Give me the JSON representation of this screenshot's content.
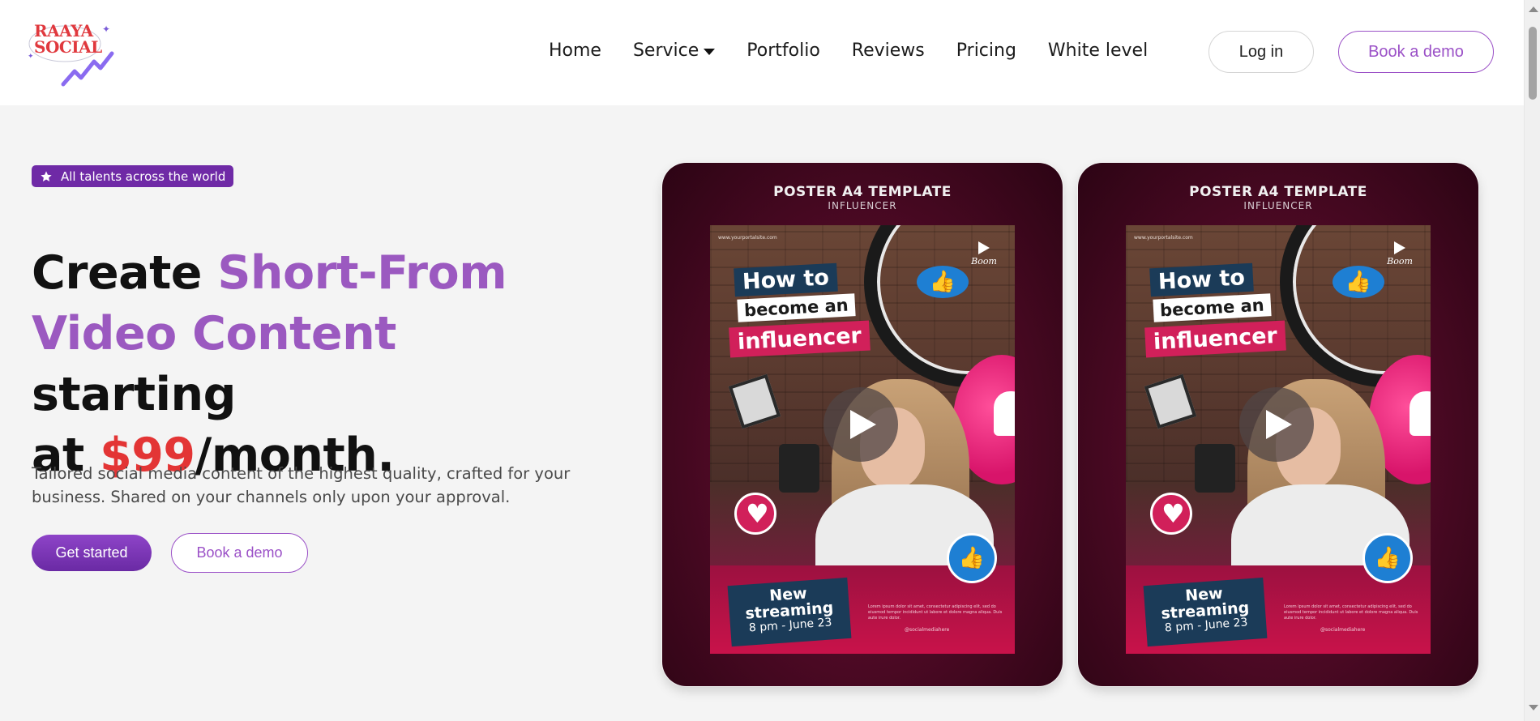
{
  "brand": {
    "logo_line1": "RAAYA",
    "logo_line2": "SOCIAL"
  },
  "nav": {
    "items": [
      {
        "label": "Home"
      },
      {
        "label": "Service"
      },
      {
        "label": "Portfolio"
      },
      {
        "label": "Reviews"
      },
      {
        "label": "Pricing"
      },
      {
        "label": "White level"
      }
    ]
  },
  "header": {
    "login_label": "Log in",
    "demo_label": "Book a demo"
  },
  "hero": {
    "badge": "All talents across the world",
    "headline": {
      "part1": "Create ",
      "part2": "Short-From",
      "part3": "Video Content",
      "part4": " starting",
      "part5": "at ",
      "part6": "$99",
      "part7": "/month."
    },
    "subtext": "Tailored social media content of the highest quality, crafted for your business. Shared on your channels only upon your approval.",
    "primary_cta": "Get started",
    "secondary_cta": "Book a demo"
  },
  "cards": [
    {
      "title": "POSTER A4 TEMPLATE",
      "subtitle": "INFLUENCER",
      "url": "www.yourportalsite.com",
      "brand_mark": "Boom",
      "tag1": "How to",
      "tag2": "become an",
      "tag3": "influencer",
      "stream_line1": "New",
      "stream_line2": "streaming",
      "stream_line3": "8 pm - June 23",
      "body": "Lorem ipsum dolor sit amet, consectetur adipiscing elit, sed do eiusmod tempor incididunt ut labore et dolore magna aliqua. Duis aute irure dolor.",
      "handle": "@socialmediahere"
    },
    {
      "title": "POSTER A4 TEMPLATE",
      "subtitle": "INFLUENCER",
      "url": "www.yourportalsite.com",
      "brand_mark": "Boom",
      "tag1": "How to",
      "tag2": "become an",
      "tag3": "influencer",
      "stream_line1": "New",
      "stream_line2": "streaming",
      "stream_line3": "8 pm - June 23",
      "body": "Lorem ipsum dolor sit amet, consectetur adipiscing elit, sed do eiusmod tempor incididunt ut labore et dolore magna aliqua. Duis aute irure dolor.",
      "handle": "@socialmediahere"
    }
  ],
  "colors": {
    "accent_purple": "#9b59c0",
    "badge_purple": "#6f2aa6",
    "price_red": "#e33535"
  }
}
